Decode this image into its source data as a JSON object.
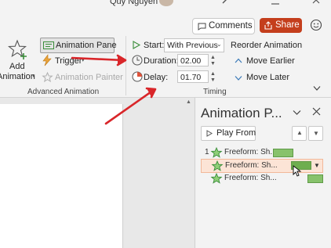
{
  "titlebar": {
    "user_name": "Quy Nguyen"
  },
  "header": {
    "comments_label": "Comments",
    "share_label": "Share"
  },
  "advanced_animation": {
    "add_animation_label_line1": "Add",
    "add_animation_label_line2": "Animation",
    "animation_pane_label": "Animation Pane",
    "trigger_label": "Trigger",
    "animation_painter_label": "Animation Painter",
    "group_label": "Advanced Animation"
  },
  "timing": {
    "start_label": "Start:",
    "start_value": "With Previous",
    "duration_label": "Duration:",
    "duration_value": "02.00",
    "delay_label": "Delay:",
    "delay_value": "01.70",
    "reorder_label": "Reorder Animation",
    "move_earlier_label": "Move Earlier",
    "move_later_label": "Move Later",
    "group_label": "Timing"
  },
  "animation_pane": {
    "title": "Animation P...",
    "play_from_label": "Play From",
    "items": [
      {
        "number": "1",
        "label": "Freeform: Sh...",
        "selected": false
      },
      {
        "number": "",
        "label": "Freeform: Sh...",
        "selected": true
      },
      {
        "number": "",
        "label": "Freeform: Sh...",
        "selected": false
      }
    ]
  },
  "colors": {
    "accent_share": "#c43e1c",
    "annotation_arrow": "#d9262a",
    "timeline_bar": "#87c26b",
    "selected_row": "#fce4d6"
  }
}
